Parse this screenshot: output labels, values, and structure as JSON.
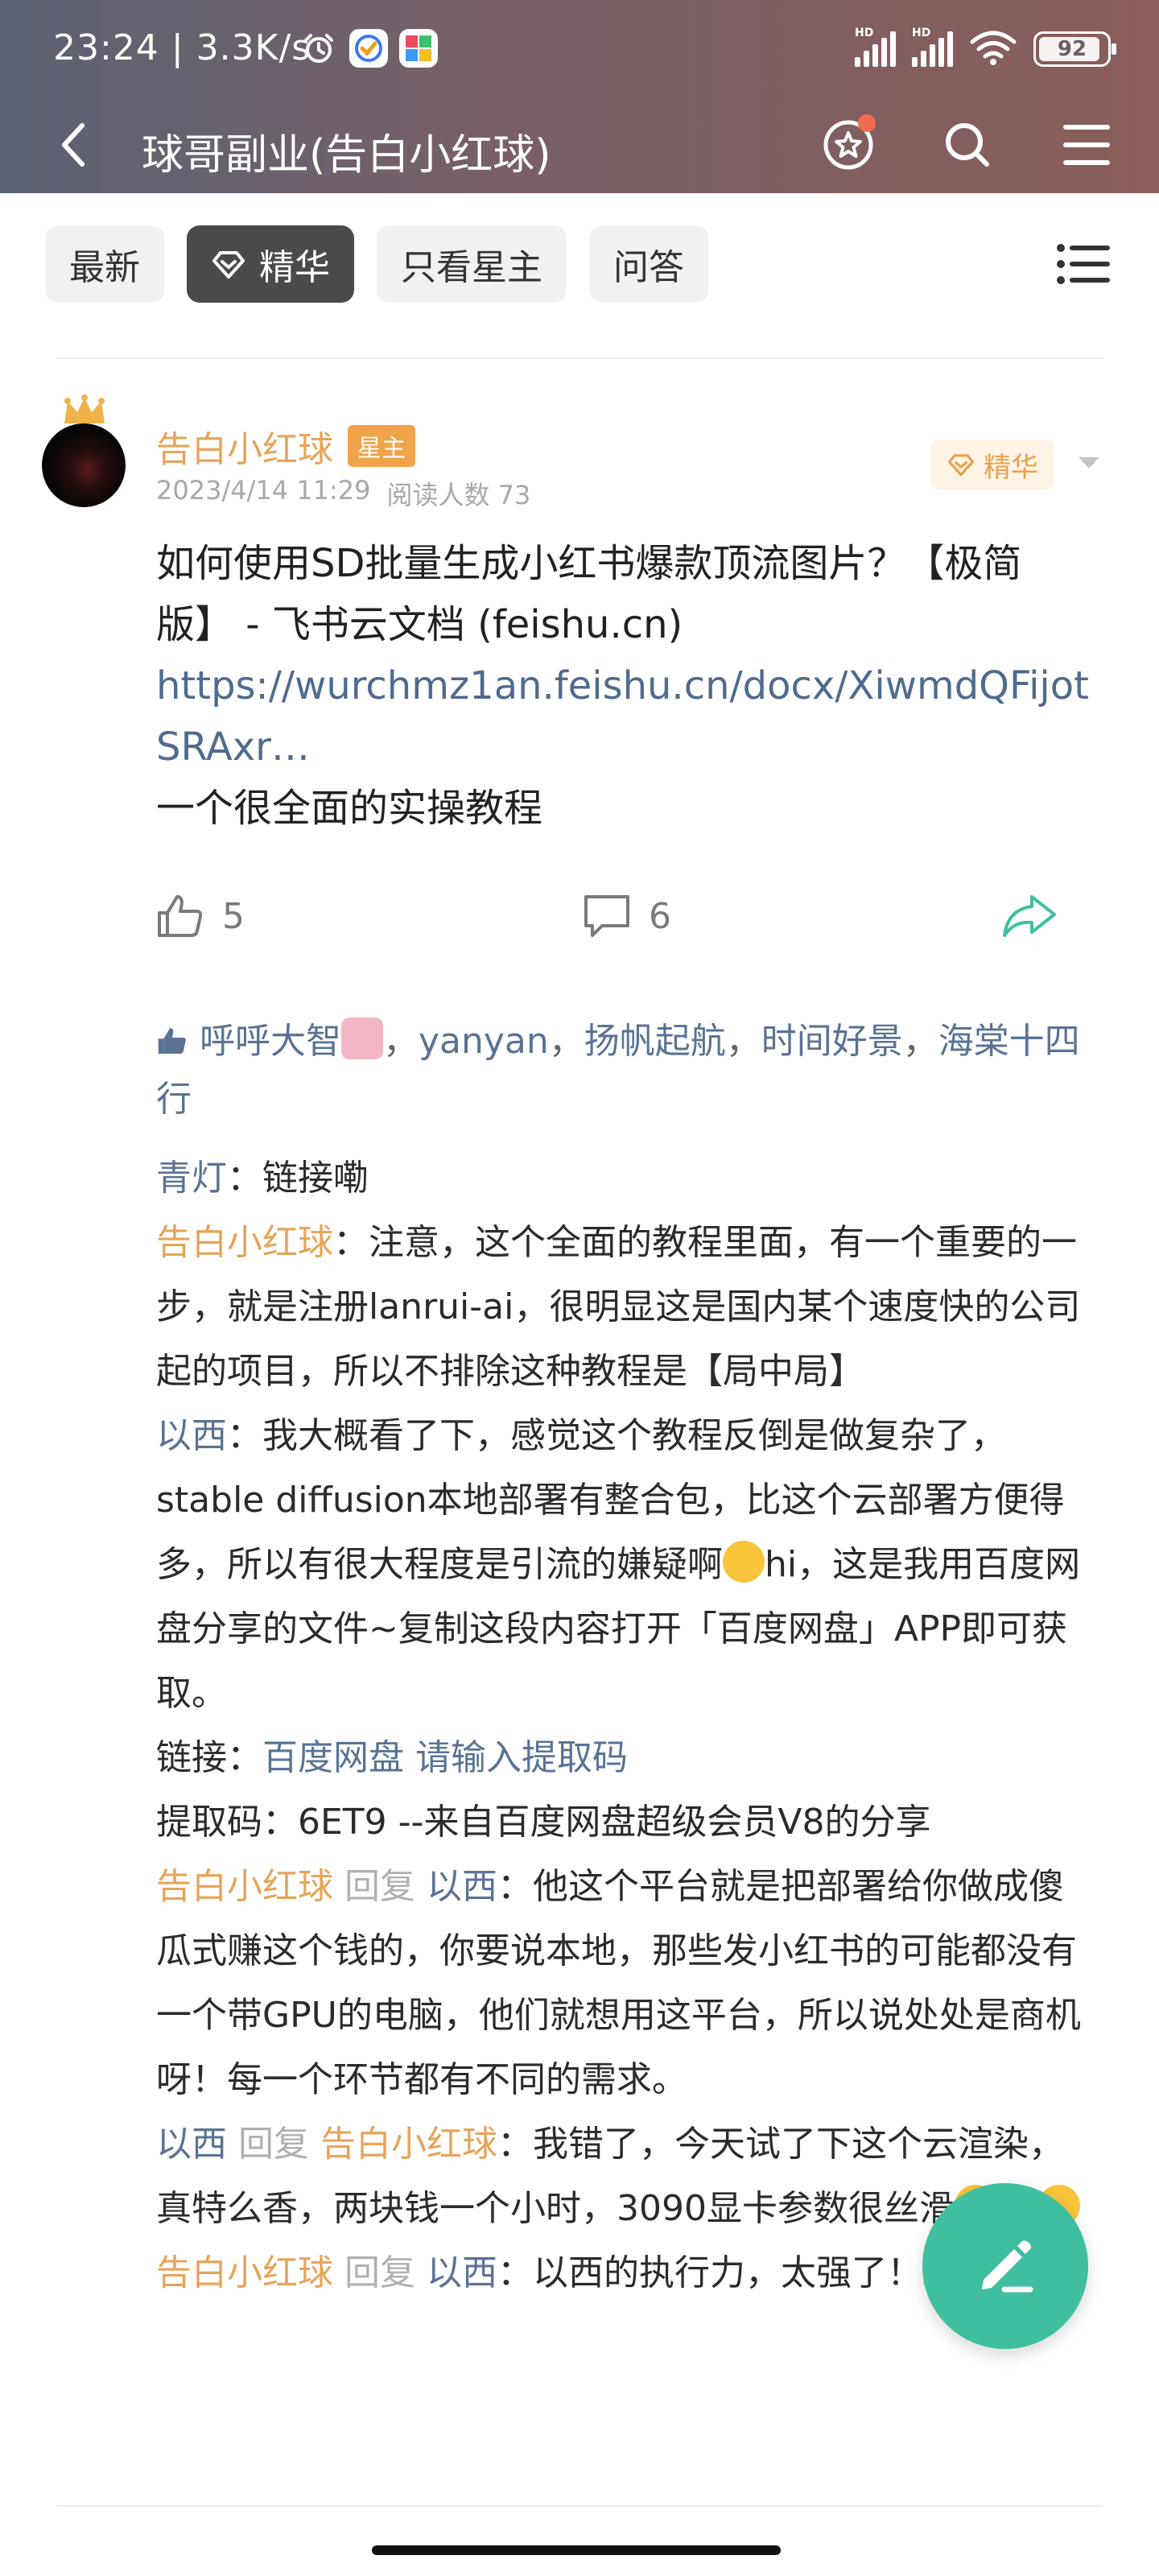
{
  "status_bar": {
    "time": "23:24",
    "speed": "3.3K/s",
    "signal_label_1": "HD",
    "signal_label_2": "HD",
    "battery": "92"
  },
  "nav": {
    "title": "球哥副业(告白小红球)"
  },
  "tabs": [
    {
      "label": "最新",
      "active": false
    },
    {
      "label": "精华",
      "active": true
    },
    {
      "label": "只看星主",
      "active": false
    },
    {
      "label": "问答",
      "active": false
    }
  ],
  "post": {
    "author": "告白小红球",
    "author_badge": "星主",
    "date": "2023/4/14 11:29",
    "readers": "阅读人数 73",
    "featured_label": "精华",
    "content_line1": "如何使用SD批量生成小红书爆款顶流图片？【极简版】 - 飞书云文档 (feishu.cn)",
    "link": "https://wurchmz1an.feishu.cn/docx/XiwmdQFijotSRAxr…",
    "content_line2": "一个很全面的实操教程",
    "like_count": "5",
    "comment_count": "6"
  },
  "likes": {
    "names": [
      "呼呼大智",
      "yanyan",
      "扬帆起航",
      "时间好景",
      "海棠十四行"
    ],
    "separator": "，"
  },
  "comments": [
    {
      "author": "青灯",
      "text": "：链接嘞"
    },
    {
      "author": "告白小红球",
      "text": "：注意，这个全面的教程里面，有一个重要的一步，就是注册lanrui-ai，很明显这是国内某个速度快的公司起的项目，所以不排除这种教程是【局中局】"
    },
    {
      "author": "以西",
      "text": "：我大概看了下，感觉这个教程反倒是做复杂了，stable diffusion本地部署有整合包，比这个云部署方便得多，所以有很大程度是引流的嫌疑啊",
      "text_after": "hi，这是我用百度网盘分享的文件~复制这段内容打开「百度网盘」APP即可获取。"
    },
    {
      "prefix": "链接：",
      "link_text": "百度网盘 请输入提取码"
    },
    {
      "text": "提取码：6ET9 --来自百度网盘超级会员V8的分享"
    },
    {
      "author": "告白小红球",
      "reply_word": "回复",
      "target": "以西",
      "text": "：他这个平台就是把部署给你做成傻瓜式赚这个钱的，你要说本地，那些发小红书的可能都没有一个带GPU的电脑，他们就想用这平台，所以说处处是商机呀！每一个环节都有不同的需求。"
    },
    {
      "author": "以西",
      "reply_word": "回复",
      "target": "告白小红球",
      "text": "：我错了，今天试了下这个云渲染，真特么香，两块钱一个小时，3090显卡参数很丝滑"
    },
    {
      "author": "告白小红球",
      "reply_word": "回复",
      "target": "以西",
      "text": "：以西的执行力，太强了！必成大器"
    }
  ],
  "colors": {
    "accent_orange": "#e6a55a",
    "link_blue": "#5a7394",
    "fab_green": "#3fbf9f"
  }
}
